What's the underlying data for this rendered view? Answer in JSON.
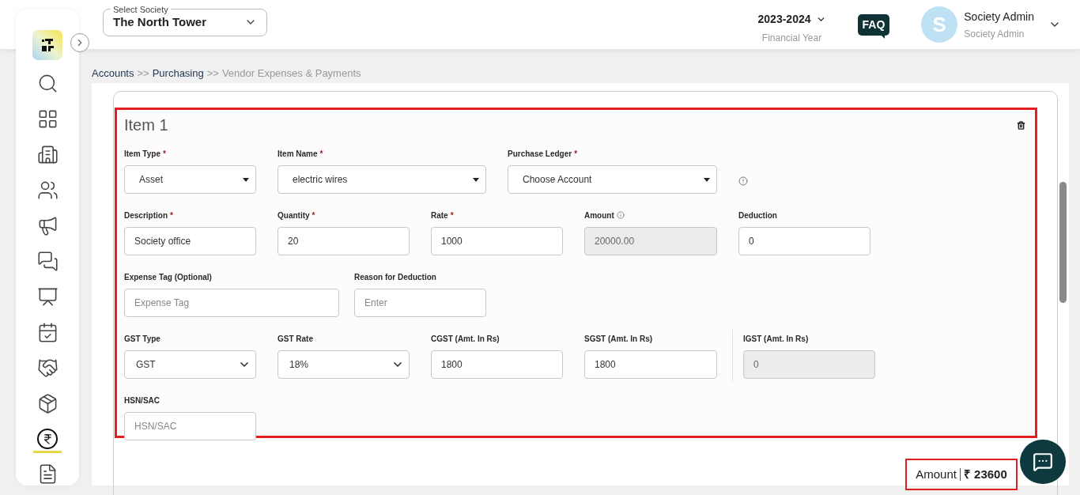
{
  "header": {
    "society_select": {
      "label": "Select Society",
      "value": "The North Tower"
    },
    "year": {
      "value": "2023-2024",
      "caption": "Financial Year"
    },
    "faq": "FAQ",
    "user": {
      "initial": "S",
      "name": "Society Admin",
      "role": "Society Admin"
    }
  },
  "sidebar": {
    "items": [
      {
        "selected": false
      },
      {
        "selected": false
      },
      {
        "selected": false
      },
      {
        "selected": false
      },
      {
        "selected": false
      },
      {
        "selected": false
      },
      {
        "selected": false
      },
      {
        "selected": false
      },
      {
        "selected": false
      },
      {
        "selected": false
      },
      {
        "selected": true
      },
      {
        "selected": false
      }
    ]
  },
  "breadcrumb": [
    {
      "label": "Accounts",
      "kind": "link"
    },
    {
      "label": ">>",
      "kind": "separator"
    },
    {
      "label": "Purchasing",
      "kind": "link"
    },
    {
      "label": ">>",
      "kind": "separator"
    },
    {
      "label": "Vendor Expenses & Payments",
      "kind": "current"
    }
  ],
  "item": {
    "title": "Item 1",
    "rows": [
      [
        {
          "label": "Item Type",
          "required_mark": "*",
          "kind": "select",
          "value": "Asset"
        },
        {
          "label": "Item Name",
          "required_mark": "*",
          "kind": "select",
          "value": "electric wires"
        },
        {
          "label": "Purchase Ledger",
          "required_mark": "*",
          "kind": "select",
          "value": "Choose Account",
          "trailing_info": true
        }
      ],
      [
        {
          "label": "Description",
          "required_mark": "*",
          "kind": "input",
          "value": "Society office"
        },
        {
          "label": "Quantity",
          "required_mark": "*",
          "kind": "input",
          "value": "20"
        },
        {
          "label": "Rate",
          "required_mark": "*",
          "kind": "input",
          "value": "1000"
        },
        {
          "label": "Amount",
          "info": true,
          "kind": "readonly",
          "value": "20000.00"
        },
        {
          "label": "Deduction",
          "kind": "input",
          "value": "0"
        }
      ],
      [
        {
          "label": "Expense Tag (Optional)",
          "kind": "input",
          "placeholder": "Expense Tag"
        },
        {
          "label": "Reason for Deduction",
          "kind": "input",
          "placeholder": "Enter"
        }
      ],
      [
        {
          "label": "GST Type",
          "kind": "native-select",
          "value": "GST"
        },
        {
          "label": "GST Rate",
          "kind": "native-select",
          "value": "18%"
        },
        {
          "label": "CGST (Amt. In Rs)",
          "kind": "input",
          "value": "1800"
        },
        {
          "label": "SGST (Amt. In Rs)",
          "kind": "input",
          "value": "1800"
        },
        {
          "label": "IGST (Amt. In Rs)",
          "kind": "readonly",
          "value": "0",
          "divider_before": true
        }
      ],
      [
        {
          "label": "HSN/SAC",
          "kind": "input",
          "placeholder": "HSN/SAC"
        }
      ]
    ]
  },
  "total": {
    "label": "Amount",
    "currency": "₹",
    "value": "23600"
  }
}
